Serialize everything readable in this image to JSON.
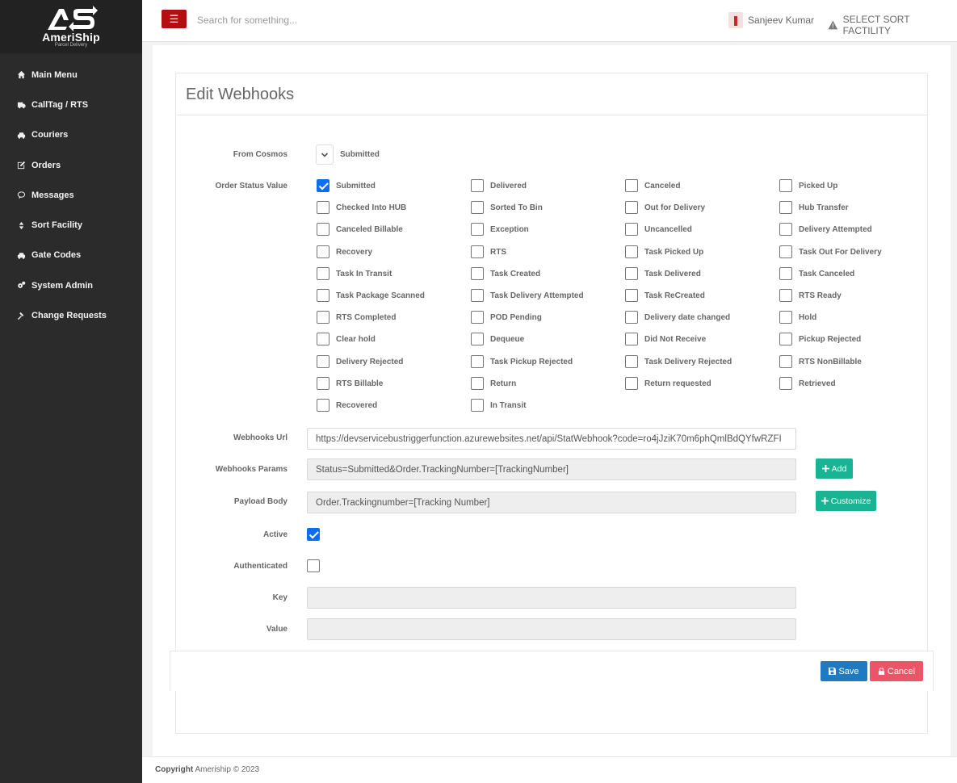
{
  "brand": {
    "name": "AmeriShip",
    "tagline": "Parcel Delivery",
    "accent": "#b40f10"
  },
  "sidebar": {
    "items": [
      {
        "label": "Main Menu",
        "icon": "home-icon"
      },
      {
        "label": "CallTag / RTS",
        "icon": "truck-icon"
      },
      {
        "label": "Couriers",
        "icon": "car-icon"
      },
      {
        "label": "Orders",
        "icon": "edit-icon"
      },
      {
        "label": "Messages",
        "icon": "comment-icon"
      },
      {
        "label": "Sort Facility",
        "icon": "sort-icon"
      },
      {
        "label": "Gate Codes",
        "icon": "car-icon"
      },
      {
        "label": "System Admin",
        "icon": "cogs-icon"
      },
      {
        "label": "Change Requests",
        "icon": "gavel-icon"
      }
    ]
  },
  "header": {
    "search_placeholder": "Search for something...",
    "user_name": "Sanjeev Kumar",
    "facility_label": "SELECT SORT FACTILITY"
  },
  "form": {
    "title": "Edit Webhooks",
    "from_cosmos_label": "From Cosmos",
    "from_cosmos_value": "Submitted",
    "order_status_label": "Order Status Value",
    "statuses": [
      {
        "label": "Submitted",
        "checked": true
      },
      {
        "label": "Delivered",
        "checked": false
      },
      {
        "label": "Canceled",
        "checked": false
      },
      {
        "label": "Picked Up",
        "checked": false
      },
      {
        "label": "Checked Into HUB",
        "checked": false
      },
      {
        "label": "Sorted To Bin",
        "checked": false
      },
      {
        "label": "Out for Delivery",
        "checked": false
      },
      {
        "label": "Hub Transfer",
        "checked": false
      },
      {
        "label": "Canceled Billable",
        "checked": false
      },
      {
        "label": "Exception",
        "checked": false
      },
      {
        "label": "Uncancelled",
        "checked": false
      },
      {
        "label": "Delivery Attempted",
        "checked": false
      },
      {
        "label": "Recovery",
        "checked": false
      },
      {
        "label": "RTS",
        "checked": false
      },
      {
        "label": "Task Picked Up",
        "checked": false
      },
      {
        "label": "Task Out For Delivery",
        "checked": false
      },
      {
        "label": "Task In Transit",
        "checked": false
      },
      {
        "label": "Task Created",
        "checked": false
      },
      {
        "label": "Task Delivered",
        "checked": false
      },
      {
        "label": "Task Canceled",
        "checked": false
      },
      {
        "label": "Task Package Scanned",
        "checked": false
      },
      {
        "label": "Task Delivery Attempted",
        "checked": false
      },
      {
        "label": "Task ReCreated",
        "checked": false
      },
      {
        "label": "RTS Ready",
        "checked": false
      },
      {
        "label": "RTS Completed",
        "checked": false
      },
      {
        "label": "POD Pending",
        "checked": false
      },
      {
        "label": "Delivery date changed",
        "checked": false
      },
      {
        "label": "Hold",
        "checked": false
      },
      {
        "label": "Clear hold",
        "checked": false
      },
      {
        "label": "Dequeue",
        "checked": false
      },
      {
        "label": "Did Not Receive",
        "checked": false
      },
      {
        "label": "Pickup Rejected",
        "checked": false
      },
      {
        "label": "Delivery Rejected",
        "checked": false
      },
      {
        "label": "Task Pickup Rejected",
        "checked": false
      },
      {
        "label": "Task Delivery Rejected",
        "checked": false
      },
      {
        "label": "RTS NonBillable",
        "checked": false
      },
      {
        "label": "RTS Billable",
        "checked": false
      },
      {
        "label": "Return",
        "checked": false
      },
      {
        "label": "Return requested",
        "checked": false
      },
      {
        "label": "Retrieved",
        "checked": false
      },
      {
        "label": "Recovered",
        "checked": false
      },
      {
        "label": "In Transit",
        "checked": false
      }
    ],
    "webhooks_url_label": "Webhooks Url",
    "webhooks_url_value": "https://devservicebustriggerfunction.azurewebsites.net/api/StatWebhook?code=ro4jJziK70m6phQmlBdQYfwRZFI",
    "webhooks_params_label": "Webhooks Params",
    "webhooks_params_value": "Status=Submitted&Order.TrackingNumber=[TrackingNumber]",
    "add_label": "Add",
    "payload_body_label": "Payload Body",
    "payload_body_value": "Order.Trackingnumber=[Tracking Number]",
    "customize_label": "Customize",
    "active_label": "Active",
    "active_checked": true,
    "authenticated_label": "Authenticated",
    "authenticated_checked": false,
    "key_label": "Key",
    "key_value": "",
    "value_label": "Value",
    "value_value": "",
    "save_label": "Save",
    "cancel_label": "Cancel"
  },
  "footer": {
    "copyright_label": "Copyright",
    "copyright_text": "Ameriship © 2023"
  }
}
